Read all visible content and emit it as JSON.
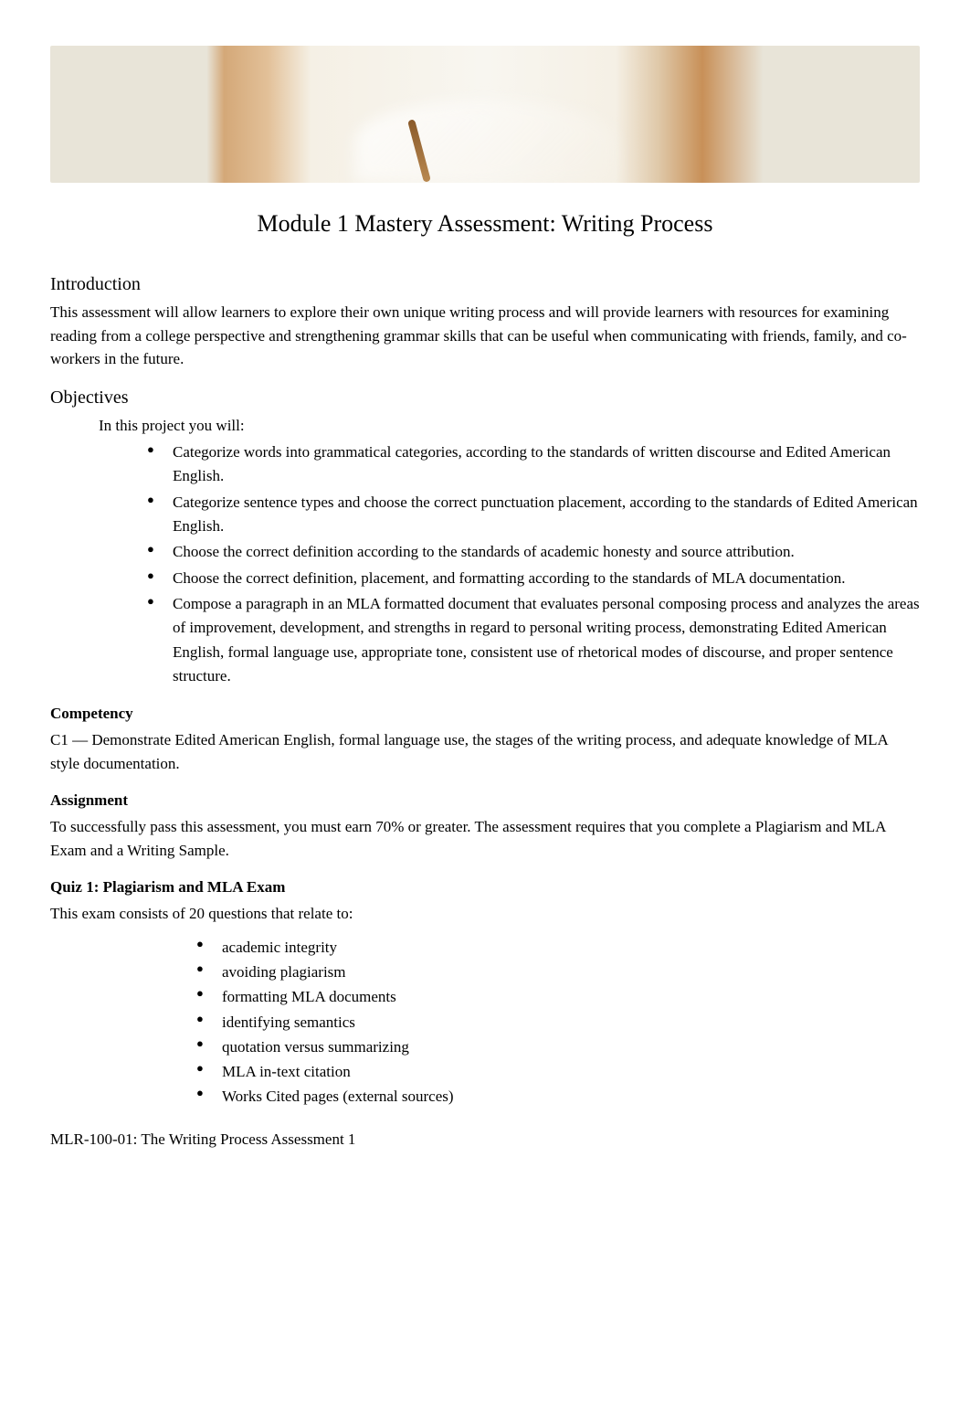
{
  "page_title": "Module 1 Mastery Assessment: Writing Process",
  "introduction": {
    "heading": "Introduction",
    "text": "This assessment will allow learners to explore their own unique writing process and will provide learners with resources for examining reading from a college perspective and strengthening grammar skills that can be useful when communicating with friends, family, and co-workers in the future."
  },
  "objectives": {
    "heading": "Objectives",
    "intro": "In this project you will:",
    "items": [
      "Categorize words into grammatical categories, according to the standards of written discourse and Edited American English.",
      "Categorize sentence types and choose the correct punctuation placement, according to the standards of Edited American English.",
      "Choose the correct definition according to the standards of academic honesty and source attribution.",
      "Choose the correct definition, placement, and formatting according to the standards of MLA documentation.",
      "Compose a paragraph in an MLA formatted document that evaluates personal composing process and analyzes the areas of improvement, development, and strengths in regard to personal writing process, demonstrating Edited American English, formal language use, appropriate tone, consistent use of rhetorical modes of discourse, and proper sentence structure."
    ]
  },
  "competency": {
    "heading": "Competency",
    "text": "C1 — Demonstrate Edited American English, formal language use, the stages of the writing process, and adequate knowledge of MLA style documentation."
  },
  "assignment": {
    "heading": "Assignment",
    "text": "To successfully pass this assessment, you must earn 70% or greater. The assessment requires that you complete a Plagiarism and MLA Exam and a Writing Sample."
  },
  "quiz": {
    "heading": "Quiz 1: Plagiarism and MLA Exam",
    "intro": "This exam consists of 20 questions that relate to:",
    "items": [
      "academic integrity",
      "avoiding plagiarism",
      "formatting MLA documents",
      "identifying semantics",
      "quotation versus summarizing",
      "MLA in-text citation",
      "Works Cited pages (external sources)"
    ]
  },
  "footer_line": "MLR-100-01: The Writing Process Assessment 1"
}
